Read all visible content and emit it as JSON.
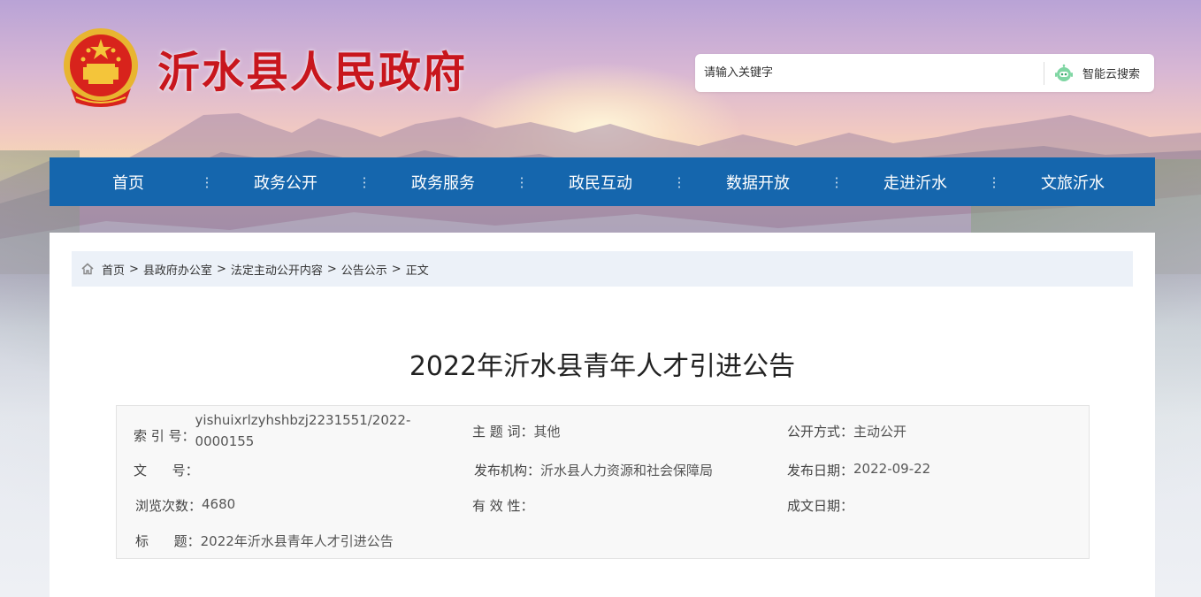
{
  "header": {
    "site_title": "沂水县人民政府",
    "emblem_icon": "national-emblem-icon",
    "brand_color": "#c8161d"
  },
  "search": {
    "placeholder": "请输入关键字",
    "button_label": "智能云搜索",
    "button_icon": "robot-icon"
  },
  "nav": {
    "color": "#1566ad",
    "items": [
      "首页",
      "政务公开",
      "政务服务",
      "政民互动",
      "数据开放",
      "走进沂水",
      "文旅沂水"
    ]
  },
  "breadcrumb": {
    "home_icon": "home-icon",
    "items": [
      "首页",
      "县政府办公室",
      "法定主动公开内容",
      "公告公示"
    ],
    "current": "正文",
    "separator": ">"
  },
  "article": {
    "title": "2022年沂水县青年人才引进公告"
  },
  "meta": {
    "index_label": "索 引 号：",
    "index_value": "yishuixrlzyhshbzj2231551/2022-0000155",
    "subject_label": "主 题 词：",
    "subject_value": "其他",
    "open_mode_label": "公开方式：",
    "open_mode_value": "主动公开",
    "doc_no_label": "文      号：",
    "doc_no_value": "",
    "publisher_label": "发布机构：",
    "publisher_value": "沂水县人力资源和社会保障局",
    "publish_date_label": "发布日期：",
    "publish_date_value": "2022-09-22",
    "views_label": "浏览次数：",
    "views_value": "4680",
    "validity_label": "有 效 性：",
    "validity_value": "",
    "written_date_label": "成文日期：",
    "written_date_value": "",
    "title_label": "标      题：",
    "title_value": "2022年沂水县青年人才引进公告"
  }
}
